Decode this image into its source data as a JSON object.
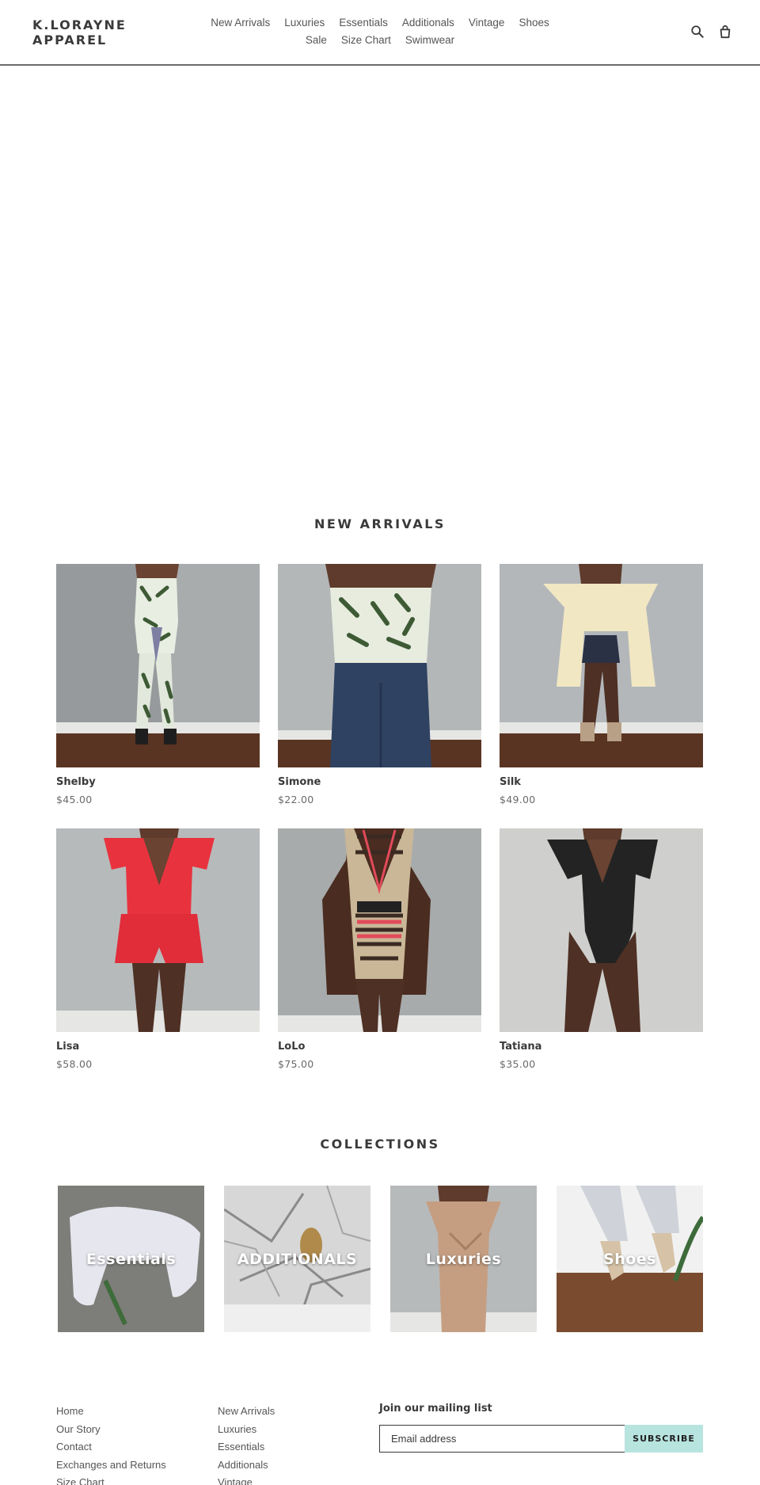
{
  "header": {
    "logo": "K.LORAYNE APPAREL",
    "nav": [
      "New Arrivals",
      "Luxuries",
      "Essentials",
      "Additionals",
      "Vintage",
      "Shoes",
      "Sale",
      "Size Chart",
      "Swimwear"
    ],
    "icons": [
      "search-icon",
      "cart-icon"
    ]
  },
  "new_arrivals": {
    "title": "NEW ARRIVALS",
    "products": [
      {
        "name": "Shelby",
        "price": "$45.00"
      },
      {
        "name": "Simone",
        "price": "$22.00"
      },
      {
        "name": "Silk",
        "price": "$49.00"
      },
      {
        "name": "Lisa",
        "price": "$58.00"
      },
      {
        "name": "LoLo",
        "price": "$75.00"
      },
      {
        "name": "Tatiana",
        "price": "$35.00"
      }
    ]
  },
  "collections": {
    "title": "COLLECTIONS",
    "items": [
      "Essentials",
      "ADDITIONALS",
      "Luxuries",
      "Shoes"
    ]
  },
  "footer": {
    "col1": [
      "Home",
      "Our Story",
      "Contact",
      "Exchanges and Returns",
      "Size Chart"
    ],
    "col2": [
      "New Arrivals",
      "Luxuries",
      "Essentials",
      "Additionals",
      "Vintage"
    ],
    "mailing_title": "Join our mailing list",
    "email_placeholder": "Email address",
    "subscribe_label": "SUBSCRIBE"
  },
  "colors": {
    "accent": "#b8e4e0",
    "text": "#3a3a3a",
    "wall": "#b9bcbd",
    "floor": "#5a3422"
  }
}
